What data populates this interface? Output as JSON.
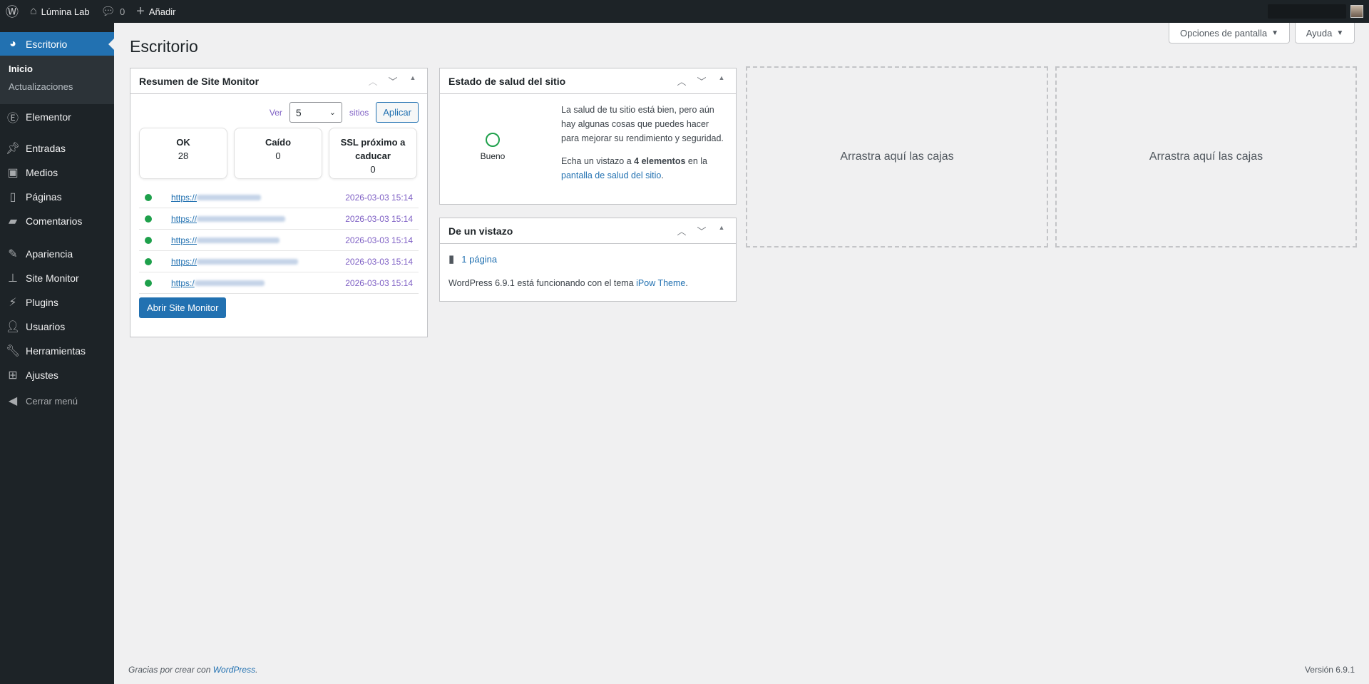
{
  "adminbar": {
    "site_name": "Lúmina Lab",
    "comments_count": "0",
    "add_new": "Añadir"
  },
  "sidebar": {
    "current": "Escritorio",
    "submenu": [
      "Inicio",
      "Actualizaciones"
    ],
    "items": [
      {
        "label": "Elementor",
        "icon": "elementor-icon"
      },
      {
        "label": "Entradas",
        "icon": "pin-icon"
      },
      {
        "label": "Medios",
        "icon": "media-icon"
      },
      {
        "label": "Páginas",
        "icon": "pages-icon"
      },
      {
        "label": "Comentarios",
        "icon": "comment-icon"
      },
      {
        "label": "Apariencia",
        "icon": "brush-icon"
      },
      {
        "label": "Site Monitor",
        "icon": "sitemap-icon"
      },
      {
        "label": "Plugins",
        "icon": "plugin-icon"
      },
      {
        "label": "Usuarios",
        "icon": "user-icon"
      },
      {
        "label": "Herramientas",
        "icon": "wrench-icon"
      },
      {
        "label": "Ajustes",
        "icon": "settings-icon"
      }
    ],
    "collapse": "Cerrar menú"
  },
  "page_title": "Escritorio",
  "screen_options": "Opciones de pantalla",
  "help": "Ayuda",
  "site_monitor": {
    "title": "Resumen de Site Monitor",
    "view_label": "Ver",
    "view_value": "5",
    "sites_label": "sitios",
    "apply": "Aplicar",
    "stats": [
      {
        "label": "OK",
        "value": "28"
      },
      {
        "label": "Caído",
        "value": "0"
      },
      {
        "label": "SSL próximo a caducar",
        "value": "0"
      }
    ],
    "rows": [
      {
        "url": "https://",
        "time": "2026-03-03 15:14",
        "status_color": "#1ea04b"
      },
      {
        "url": "https://",
        "time": "2026-03-03 15:14",
        "status_color": "#1ea04b"
      },
      {
        "url": "https://",
        "time": "2026-03-03 15:14",
        "status_color": "#1ea04b"
      },
      {
        "url": "https://",
        "time": "2026-03-03 15:14",
        "status_color": "#1ea04b"
      },
      {
        "url": "https:/",
        "time": "2026-03-03 15:14",
        "status_color": "#1ea04b"
      }
    ],
    "open_button": "Abrir Site Monitor"
  },
  "site_health": {
    "title": "Estado de salud del sitio",
    "status": "Bueno",
    "text": "La salud de tu sitio está bien, pero aún hay algunas cosas que puedes hacer para mejorar su rendimiento y seguridad.",
    "look_prefix": "Echa un vistazo a ",
    "look_count": "4 elementos",
    "look_suffix": " en la ",
    "link": "pantalla de salud del sitio",
    "end": "."
  },
  "glance": {
    "title": "De un vistazo",
    "pages": "1 página",
    "wp_prefix": "WordPress 6.9.1 está funcionando con el tema ",
    "theme": "iPow Theme",
    "end": "."
  },
  "drop_zone": "Arrastra aquí las cajas",
  "footer": {
    "thanks": "Gracias por crear con ",
    "wp_link": "WordPress",
    "end": ".",
    "version": "Versión 6.9.1"
  }
}
